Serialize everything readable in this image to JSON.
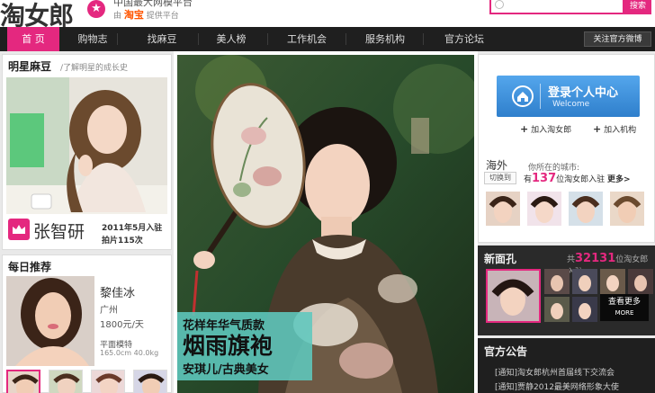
{
  "header": {
    "logo_text": "淘女郎",
    "tagline": "中国最大网模平台",
    "subtag_prefix": "由",
    "subtag_brand": "淘宝",
    "subtag_suffix": "提供平台",
    "search_placeholder": "",
    "search_button": "搜索"
  },
  "nav": {
    "items": [
      "首 页",
      "购物志",
      "找麻豆",
      "美人榜",
      "工作机会",
      "服务机构",
      "官方论坛"
    ],
    "follow": "关注官方微博"
  },
  "star_card": {
    "title": "明星麻豆",
    "subtitle": "/了解明星的成长史",
    "name": "张智研",
    "joined": "2011年5月入驻",
    "photos": "拍片115次"
  },
  "daily": {
    "title": "每日推荐",
    "name": "黎佳冰",
    "city": "广州",
    "price": "1800元/天",
    "type": "平面模特",
    "stats": "165.0cm 40.0kg"
  },
  "banner": {
    "caption_line1": "花样年华气质款",
    "caption_line2": "烟雨旗袍",
    "caption_line3": "安琪儿/古典美女"
  },
  "login": {
    "title": "登录个人中心",
    "subtitle": "Welcome",
    "join_model": "加入淘女郎",
    "join_agency": "加入机构"
  },
  "city": {
    "label": "海外",
    "switch": "切换到",
    "info_line1": "你所在的城市:",
    "info_prefix": "有",
    "count": "137",
    "info_suffix": "位淘女郎入驻",
    "more": "更多>"
  },
  "new_faces": {
    "title": "新面孔",
    "count_prefix": "共",
    "count": "32131",
    "count_suffix": "位淘女郎入驻",
    "see_more": "查看更多",
    "see_more_en": "MORE"
  },
  "notices": {
    "title": "官方公告",
    "items": [
      "[通知]淘女郎杭州首届线下交流会",
      "[通知]贾静2012最美网络形象大使"
    ]
  },
  "colors": {
    "brand_pink": "#e4287f",
    "nav_dark": "#1f1f1f",
    "login_blue": "#3f8fdc",
    "caption_teal": "#5fc8be"
  }
}
